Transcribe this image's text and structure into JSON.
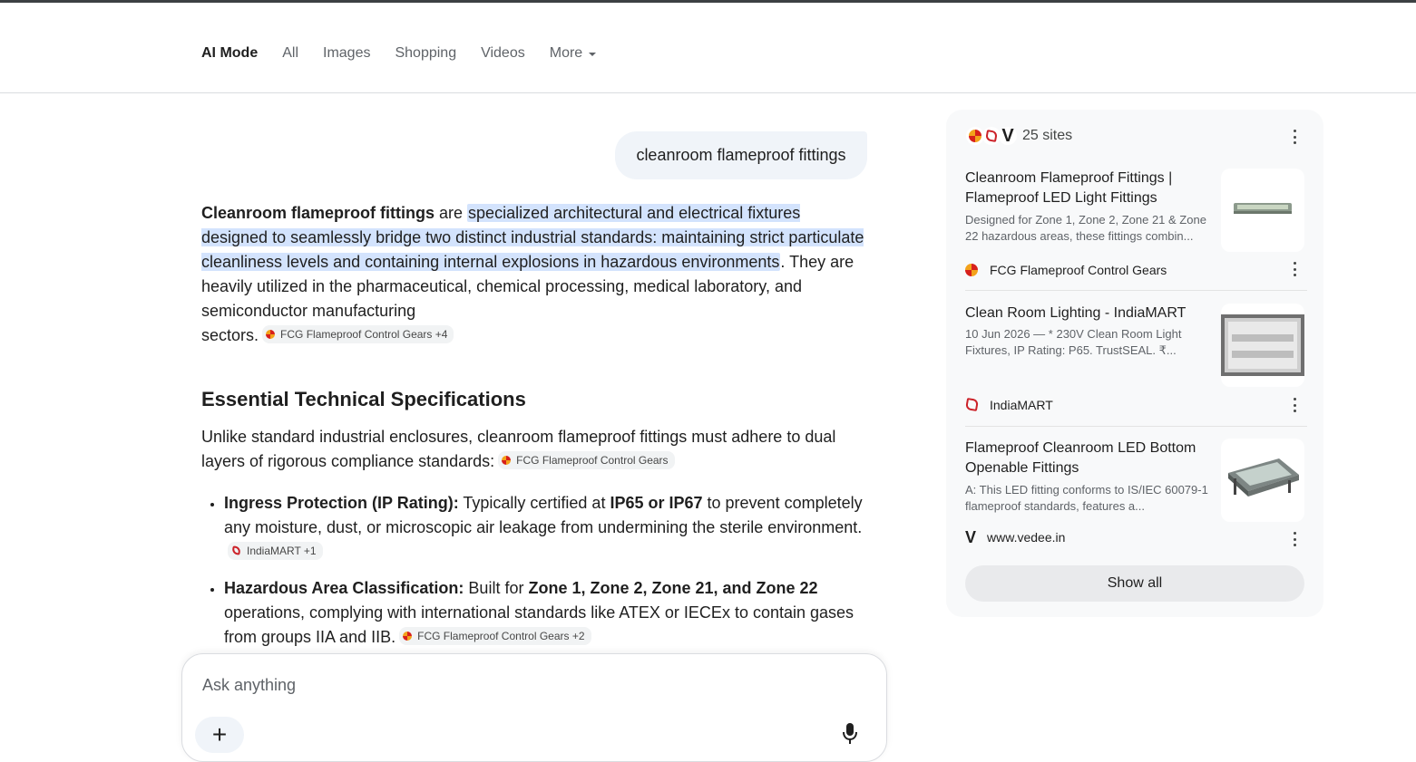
{
  "tabs": [
    {
      "label": "AI Mode",
      "active": true
    },
    {
      "label": "All"
    },
    {
      "label": "Images"
    },
    {
      "label": "Shopping"
    },
    {
      "label": "Videos"
    },
    {
      "label": "More",
      "dropdown": true
    }
  ],
  "query": "cleanroom flameproof fittings",
  "answer": {
    "intro_bold": "Cleanroom flameproof fittings",
    "intro_are": " are ",
    "intro_highlight": "specialized architectural and electrical fixtures designed to seamlessly bridge two distinct industrial standards: maintaining strict particulate cleanliness levels and containing internal explosions in hazardous environments",
    "intro_rest": ". They are heavily utilized in the pharmaceutical, chemical processing, medical laboratory, and semiconductor manufacturing",
    "intro_end": "sectors.",
    "intro_chip": "FCG Flameproof Control Gears +4",
    "heading": "Essential Technical Specifications",
    "lead": "Unlike standard industrial enclosures, cleanroom flameproof fittings must adhere to dual layers of rigorous compliance standards:",
    "lead_chip": "FCG Flameproof Control Gears",
    "bullets": [
      {
        "label": "Ingress Protection (IP Rating):",
        "t1": " Typically certified at ",
        "b1": "IP65 or IP67",
        "t2": " to prevent completely any moisture, dust, or microscopic air leakage from undermining the sterile environment.",
        "chip": "IndiaMART +1"
      },
      {
        "label": "Hazardous Area Classification:",
        "t1": " Built for ",
        "b1": "Zone 1, Zone 2, Zone 21, and Zone 22",
        "t2": " operations, complying with international standards like ATEX or IECEx to contain gases from groups IIA and IIB.",
        "chip": "FCG Flameproof Control Gears +2"
      }
    ]
  },
  "ask": {
    "placeholder": "Ask anything",
    "plus": "+"
  },
  "panel": {
    "sites_label": "25 sites",
    "sources": [
      {
        "title": "Cleanroom Flameproof Fittings | Flameproof LED Light Fittings",
        "snippet": "Designed for Zone 1, Zone 2, Zone 21 & Zone 22 hazardous areas, these fittings combin...",
        "site": "FCG Flameproof Control Gears",
        "logo": "fcg-logo"
      },
      {
        "title": "Clean Room Lighting - IndiaMART",
        "snippet": "10 Jun 2026 — * 230V Clean Room Light Fixtures, IP Rating: P65. TrustSEAL. ₹...",
        "site": "IndiaMART",
        "logo": "indiamart-logo"
      },
      {
        "title": "Flameproof Cleanroom LED Bottom Openable Fittings",
        "snippet": "A: This LED fitting conforms to IS/IEC 60079-1 flameproof standards, features a...",
        "site": "www.vedee.in",
        "logo": "vedee-logo",
        "logo_text": "V"
      }
    ],
    "show_all": "Show all"
  }
}
